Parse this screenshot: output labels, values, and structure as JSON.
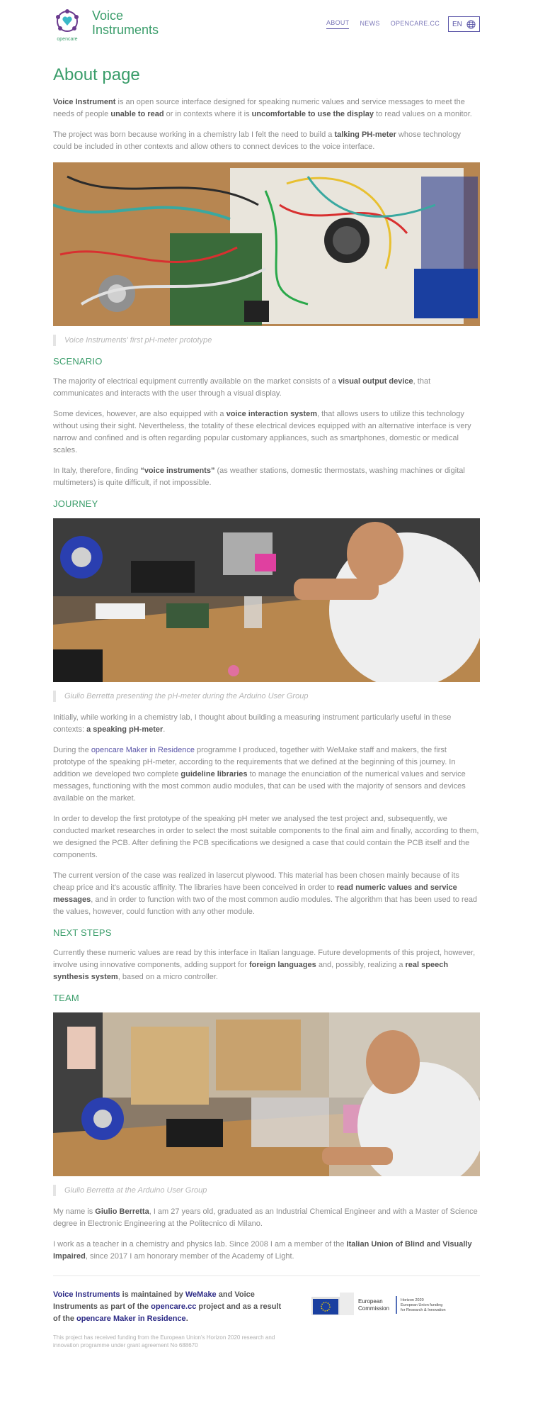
{
  "header": {
    "logo_caption": "opencare",
    "brand_line1": "Voice",
    "brand_line2": "Instruments",
    "nav": [
      "ABOUT",
      "NEWS",
      "OPENCARE.CC"
    ],
    "lang": "EN"
  },
  "page_title": "About page",
  "intro": {
    "p1": [
      {
        "b": "Voice Instrument"
      },
      {
        "t": " is an open source interface designed for speaking numeric values and service messages to meet the needs of people "
      },
      {
        "b": "unable to read"
      },
      {
        "t": " or in contexts where it is "
      },
      {
        "b": "uncomfortable to use the display"
      },
      {
        "t": " to read values on a monitor."
      }
    ],
    "p2": [
      {
        "t": "The project was born because working in a chemistry lab I felt the need to build a "
      },
      {
        "b": "talking PH-meter"
      },
      {
        "t": " whose technology could be included in other contexts and allow others to connect devices to the voice interface."
      }
    ]
  },
  "caption1": "Voice Instruments' first pH-meter prototype",
  "scenario": {
    "heading": "SCENARIO",
    "p1": [
      {
        "t": "The majority of electrical equipment currently available on the market consists of a "
      },
      {
        "b": "visual output device"
      },
      {
        "t": ", that communicates and interacts with the user through a visual display."
      }
    ],
    "p2": [
      {
        "t": "Some devices, however, are also equipped with a "
      },
      {
        "b": "voice interaction system"
      },
      {
        "t": ", that allows users to utilize this technology without using their sight. Nevertheless, the totality of these electrical devices equipped with an alternative interface is very narrow and confined and is often regarding popular customary appliances, such as smartphones, domestic or medical scales."
      }
    ],
    "p3": [
      {
        "t": "In Italy, therefore, finding "
      },
      {
        "b": "“voice instruments”"
      },
      {
        "t": " (as weather stations, domestic thermostats, washing machines or digital multimeters) is quite difficult, if not impossible."
      }
    ]
  },
  "journey": {
    "heading": "JOURNEY",
    "caption": "Giulio Berretta presenting the pH-meter during the Arduino User Group",
    "p1": [
      {
        "t": "Initially, while working in a chemistry lab, I thought about building a measuring instrument particularly useful in these contexts: "
      },
      {
        "b": "a speaking pH-meter"
      },
      {
        "t": "."
      }
    ],
    "p2": [
      {
        "t": "During the "
      },
      {
        "a": "opencare Maker in Residence"
      },
      {
        "t": " programme I produced, together with WeMake staff and makers, the first prototype of the speaking pH-meter, according to the requirements that we defined at the beginning of this journey. In addition we developed two complete "
      },
      {
        "b": "guideline libraries"
      },
      {
        "t": " to manage the enunciation of the numerical values and service messages, functioning with the most common audio modules, that can be used with the majority of sensors and devices available on the market."
      }
    ],
    "p3": [
      {
        "t": "In order to develop the first prototype of the speaking pH meter we analysed the test project and, subsequently, we conducted market researches in order to select the most suitable components to the final aim and finally, according to them, we designed the PCB. After defining the PCB specifications we designed a case that could contain the PCB itself and the components."
      }
    ],
    "p4": [
      {
        "t": "The current version of the case was realized in lasercut plywood. This material has been chosen mainly because of its cheap price and it's acoustic affinity. The libraries have been conceived in order to "
      },
      {
        "b": "read numeric values and service messages"
      },
      {
        "t": ", and in order to function with two of the most common audio modules. The algorithm that has been used to read the values, however, could function with any other module."
      }
    ]
  },
  "next_steps": {
    "heading": "NEXT STEPS",
    "p1": [
      {
        "t": "Currently these numeric values are read by this interface in Italian language. Future developments of this project, however, involve using innovative components, adding support for "
      },
      {
        "b": "foreign languages"
      },
      {
        "t": " and, possibly, realizing a "
      },
      {
        "b": "real speech synthesis system"
      },
      {
        "t": ", based on a micro controller."
      }
    ]
  },
  "team": {
    "heading": "TEAM",
    "caption": "Giulio Berretta at the Arduino User Group",
    "p1": [
      {
        "t": "My name is "
      },
      {
        "b": "Giulio Berretta"
      },
      {
        "t": ", I am 27 years old, graduated as an Industrial Chemical Engineer and with a Master of Science degree in Electronic Engineering at the Politecnico di Milano."
      }
    ],
    "p2": [
      {
        "t": "I work as a teacher in a chemistry and physics lab. Since 2008 I am a member of the "
      },
      {
        "b": "Italian Union of Blind and Visually Impaired"
      },
      {
        "t": ", since 2017 I am honorary member of the Academy of Light."
      }
    ]
  },
  "footer": {
    "text": [
      {
        "a": "Voice Instruments"
      },
      {
        "t": " is maintained by "
      },
      {
        "a": "WeMake"
      },
      {
        "t": " and Voice Instruments as part of the "
      },
      {
        "a": "opencare.cc"
      },
      {
        "t": " project and as a result of the "
      },
      {
        "a": "opencare Maker in Residence"
      },
      {
        "t": "."
      }
    ],
    "eu_name_line1": "European",
    "eu_name_line2": "Commission",
    "eu_h2020_line1": "Horizon 2020",
    "eu_h2020_line2": "European Union funding",
    "eu_h2020_line3": "for Research & Innovation",
    "funding": "This project has received funding from the European Union's Horizon 2020 research and innovation programme under grant agreement No 688670"
  },
  "colors": {
    "green": "#3a9d6a",
    "purple": "#5b56a8",
    "text": "#8c8c8c",
    "bold": "#555555"
  },
  "icons": {
    "logo": "opencare-logo-icon",
    "lang": "globe-icon",
    "eu": "eu-flag-icon"
  }
}
